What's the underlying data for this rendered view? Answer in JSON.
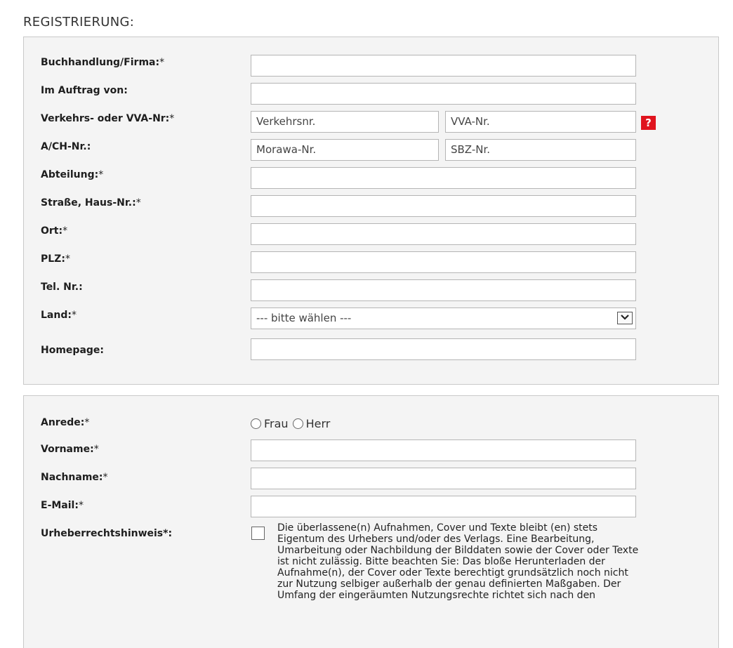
{
  "page": {
    "title": "REGISTRIERUNG:"
  },
  "company_section": {
    "buchhandlung_label": "Buchhandlung/Firma:",
    "auftrag_label": "Im Auftrag von:",
    "verkehrs_label": "Verkehrs- oder VVA-Nr:",
    "verkehrsnr_placeholder": "Verkehrsnr.",
    "vva_placeholder": "VVA-Nr.",
    "help_icon_text": "?",
    "ach_label": "A/CH-Nr.:",
    "morawa_placeholder": "Morawa-Nr.",
    "sbz_placeholder": "SBZ-Nr.",
    "abteilung_label": "Abteilung:",
    "strasse_label": "Straße, Haus-Nr.:",
    "ort_label": "Ort:",
    "plz_label": "PLZ:",
    "tel_label": "Tel. Nr.:",
    "land_label": "Land:",
    "land_selected": "--- bitte wählen ---",
    "homepage_label": "Homepage:"
  },
  "person_section": {
    "anrede_label": "Anrede:",
    "frau_label": "Frau",
    "herr_label": "Herr",
    "vorname_label": "Vorname:",
    "nachname_label": "Nachname:",
    "email_label": "E-Mail:",
    "urheber_label": "Urheberrechtshinweis*:",
    "urheber_text": "Die überlassene(n) Aufnahmen, Cover und Texte bleibt (en) stets Eigentum des Urhebers und/oder des Verlags. Eine Bearbeitung, Umarbeitung oder Nachbildung der Bilddaten sowie der Cover oder Texte ist nicht zulässig. Bitte beachten Sie: Das bloße Herunterladen der Aufnahme(n), der Cover oder Texte berechtigt grundsätzlich noch nicht zur Nutzung selbiger außerhalb der genau definierten Maßgaben. Der Umfang der eingeräumten Nutzungsrechte richtet sich nach den"
  },
  "required_marker": "*"
}
